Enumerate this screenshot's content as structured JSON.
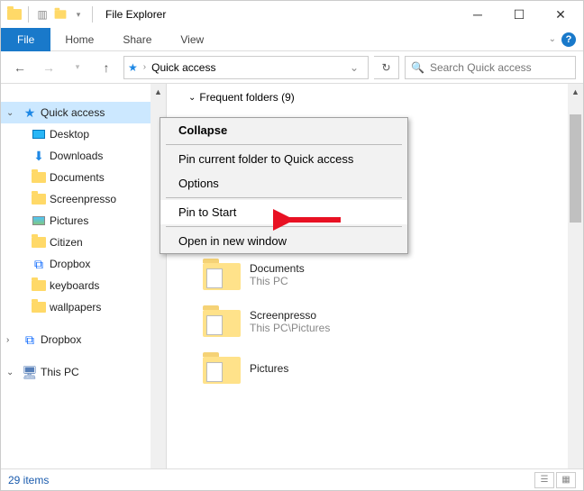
{
  "window": {
    "title": "File Explorer"
  },
  "ribbon": {
    "file": "File",
    "tabs": [
      "Home",
      "Share",
      "View"
    ]
  },
  "address": {
    "location": "Quick access",
    "search_placeholder": "Search Quick access"
  },
  "sidebar": {
    "quick_access": "Quick access",
    "items": [
      "Desktop",
      "Downloads",
      "Documents",
      "Screenpresso",
      "Pictures",
      "Citizen",
      "Dropbox",
      "keyboards",
      "wallpapers"
    ],
    "dropbox": "Dropbox",
    "this_pc": "This PC"
  },
  "content": {
    "header": "Frequent folders (9)",
    "folders": [
      {
        "name": "Documents",
        "loc": "This PC"
      },
      {
        "name": "Screenpresso",
        "loc": "This PC\\Pictures"
      },
      {
        "name": "Pictures",
        "loc": ""
      }
    ]
  },
  "context_menu": {
    "collapse": "Collapse",
    "pin_qa": "Pin current folder to Quick access",
    "options": "Options",
    "pin_start": "Pin to Start",
    "open_new": "Open in new window"
  },
  "status": {
    "count": "29 items"
  }
}
